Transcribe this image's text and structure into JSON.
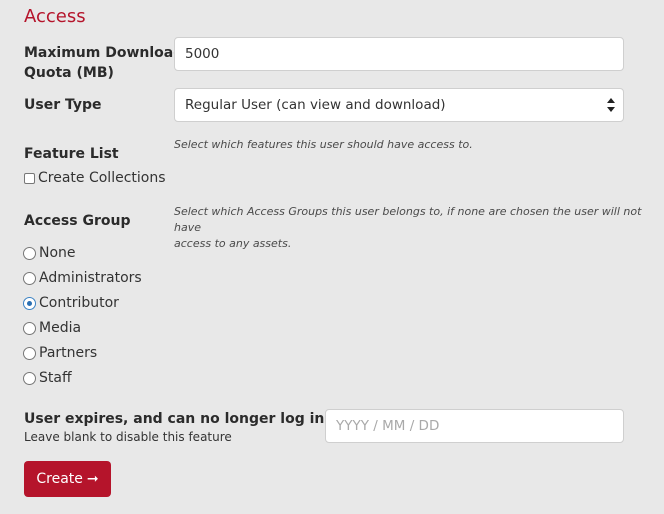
{
  "section": {
    "title": "Access"
  },
  "quota": {
    "label_line1": "Maximum Download",
    "label_line2": "Quota (MB)",
    "value": "5000"
  },
  "user_type": {
    "label": "User Type",
    "selected": "Regular User (can view and download)"
  },
  "features": {
    "label": "Feature List",
    "help": "Select which features this user should have access to.",
    "items": [
      {
        "label": "Create Collections",
        "checked": false
      }
    ]
  },
  "access_group": {
    "label": "Access Group",
    "help_line1": "Select which Access Groups this user belongs to, if none are chosen the user will not have",
    "help_line2": "access to any assets.",
    "options": [
      {
        "label": "None",
        "checked": false
      },
      {
        "label": "Administrators",
        "checked": false
      },
      {
        "label": "Contributor",
        "checked": true
      },
      {
        "label": "Media",
        "checked": false
      },
      {
        "label": "Partners",
        "checked": false
      },
      {
        "label": "Staff",
        "checked": false
      }
    ]
  },
  "expiry": {
    "label": "User expires, and can no longer log in after:",
    "sublabel": "Leave blank to disable this feature",
    "placeholder": "YYYY / MM / DD",
    "value": ""
  },
  "actions": {
    "create_label": "Create",
    "create_icon": "arrow-right-icon"
  },
  "colors": {
    "accent": "#b5142b",
    "radio_selected": "#2a6fb3",
    "background": "#e8e8e8"
  }
}
